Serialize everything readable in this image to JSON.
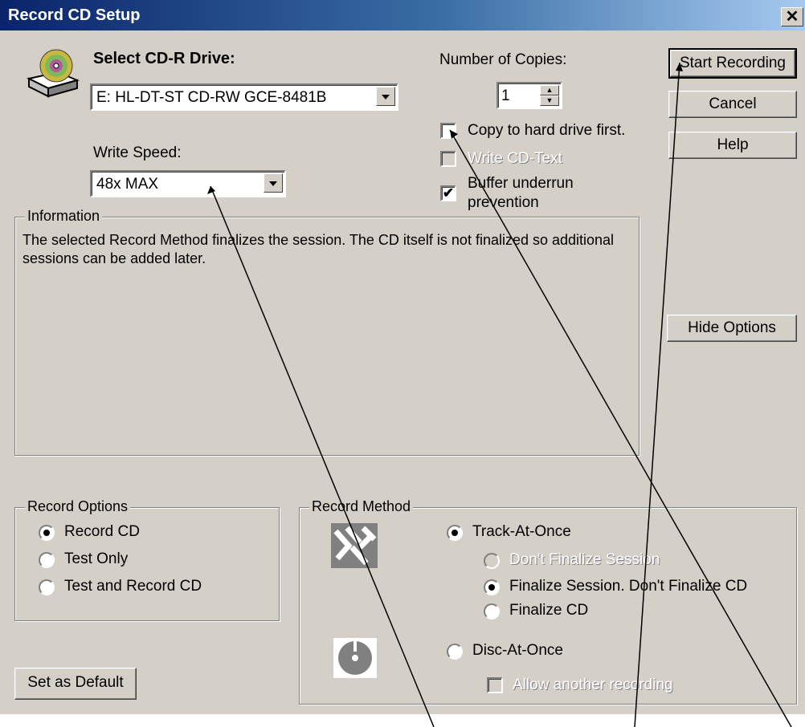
{
  "window": {
    "title": "Record CD Setup",
    "close_glyph": "✕"
  },
  "drive": {
    "label": "Select CD-R Drive:",
    "value": "E: HL-DT-ST CD-RW GCE-8481B"
  },
  "speed": {
    "label": "Write Speed:",
    "value": "48x MAX"
  },
  "copies": {
    "label": "Number of Copies:",
    "value": "1"
  },
  "options": {
    "copy_to_hd": {
      "label": "Copy to hard drive first.",
      "checked": false
    },
    "write_cd_text": {
      "label": "Write CD-Text",
      "checked": false,
      "enabled": false
    },
    "buffer_underrun": {
      "label_line1": "Buffer underrun",
      "label_line2": "prevention",
      "checked": true
    }
  },
  "buttons": {
    "start": "Start Recording",
    "cancel": "Cancel",
    "help": "Help",
    "hide_options": "Hide Options",
    "set_default": "Set as Default"
  },
  "information": {
    "label": "Information",
    "text": "The selected Record Method finalizes the session. The CD itself is not finalized so additional sessions can be added later."
  },
  "record_options": {
    "label": "Record Options",
    "items": [
      "Record CD",
      "Test Only",
      "Test and Record CD"
    ],
    "selected": 0
  },
  "record_method": {
    "label": "Record Method",
    "track_at_once": "Track-At-Once",
    "dont_finalize": "Don't Finalize Session",
    "finalize_session": "Finalize Session. Don't Finalize CD",
    "finalize_cd": "Finalize CD",
    "disc_at_once": "Disc-At-Once",
    "allow_another": "Allow another recording"
  },
  "colors": {
    "face": "#d4d0c8",
    "title_start": "#0a246a",
    "title_end": "#a6caf0"
  },
  "icons": [
    "cd-drive-icon",
    "track-at-once-icon",
    "disc-at-once-icon"
  ]
}
